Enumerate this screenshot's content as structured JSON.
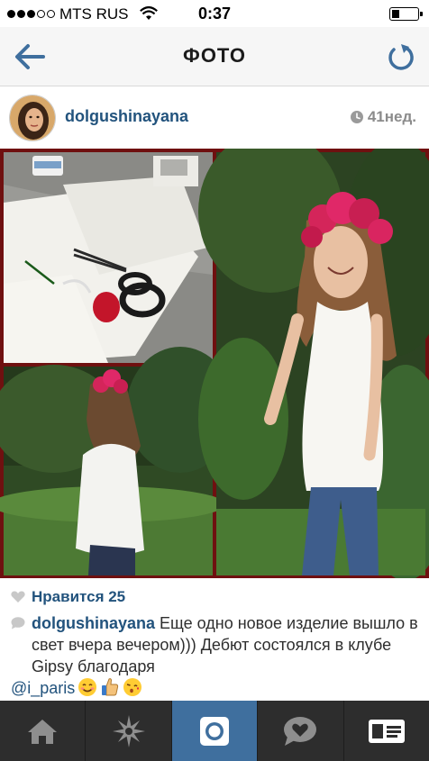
{
  "status_bar": {
    "carrier": "MTS RUS",
    "time": "0:37",
    "signal_bars_filled": 3,
    "signal_bars_total": 5
  },
  "nav": {
    "title": "ФОТО",
    "back_icon": "arrow-left-icon",
    "refresh_icon": "refresh-icon"
  },
  "post": {
    "username": "dolgushinayana",
    "time_ago": "41нед.",
    "likes_text": "Нравится 25",
    "caption": {
      "user": "dolgushinayana",
      "text_part1": " Еще одно новое изделие вышло в свет вчера вечером))) Дебют состоялся в клубе Gipsy благодаря",
      "mention": "@i_paris",
      "emojis": [
        "smiling-face-emoji",
        "thumbs-up-emoji",
        "kiss-face-emoji"
      ]
    }
  },
  "tab_bar": {
    "active_index": 2,
    "tabs": [
      "home-icon",
      "explore-icon",
      "camera-icon",
      "activity-icon",
      "profile-icon"
    ]
  },
  "colors": {
    "accent": "#22537d",
    "active_tab": "#3f6f9e",
    "tab_bar_bg": "#2d2d2d",
    "photo_border": "#6f1010"
  }
}
